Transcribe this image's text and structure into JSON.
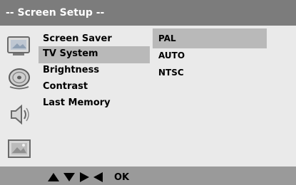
{
  "header": {
    "title": "-- Screen Setup --"
  },
  "menu": {
    "items": [
      {
        "label": "Screen Saver",
        "selected": false
      },
      {
        "label": "TV System",
        "selected": true
      },
      {
        "label": "Brightness",
        "selected": false
      },
      {
        "label": "Contrast",
        "selected": false
      },
      {
        "label": "Last Memory",
        "selected": false
      }
    ]
  },
  "options": {
    "items": [
      {
        "label": "PAL",
        "selected": true
      },
      {
        "label": "AUTO",
        "selected": false
      },
      {
        "label": "NTSC",
        "selected": false
      }
    ]
  },
  "footer": {
    "nav_icons": [
      "up-arrow-icon",
      "down-arrow-icon",
      "right-arrow-icon",
      "left-arrow-icon"
    ],
    "ok_label": "OK"
  },
  "icons": [
    "display-settings-icon",
    "disc-icon",
    "speaker-icon",
    "picture-icon"
  ],
  "colors": {
    "header_bg": "#7c7c7c",
    "body_bg": "#eaeaea",
    "highlight": "#b9b9b9",
    "footer_bg": "#9a9a9a"
  }
}
